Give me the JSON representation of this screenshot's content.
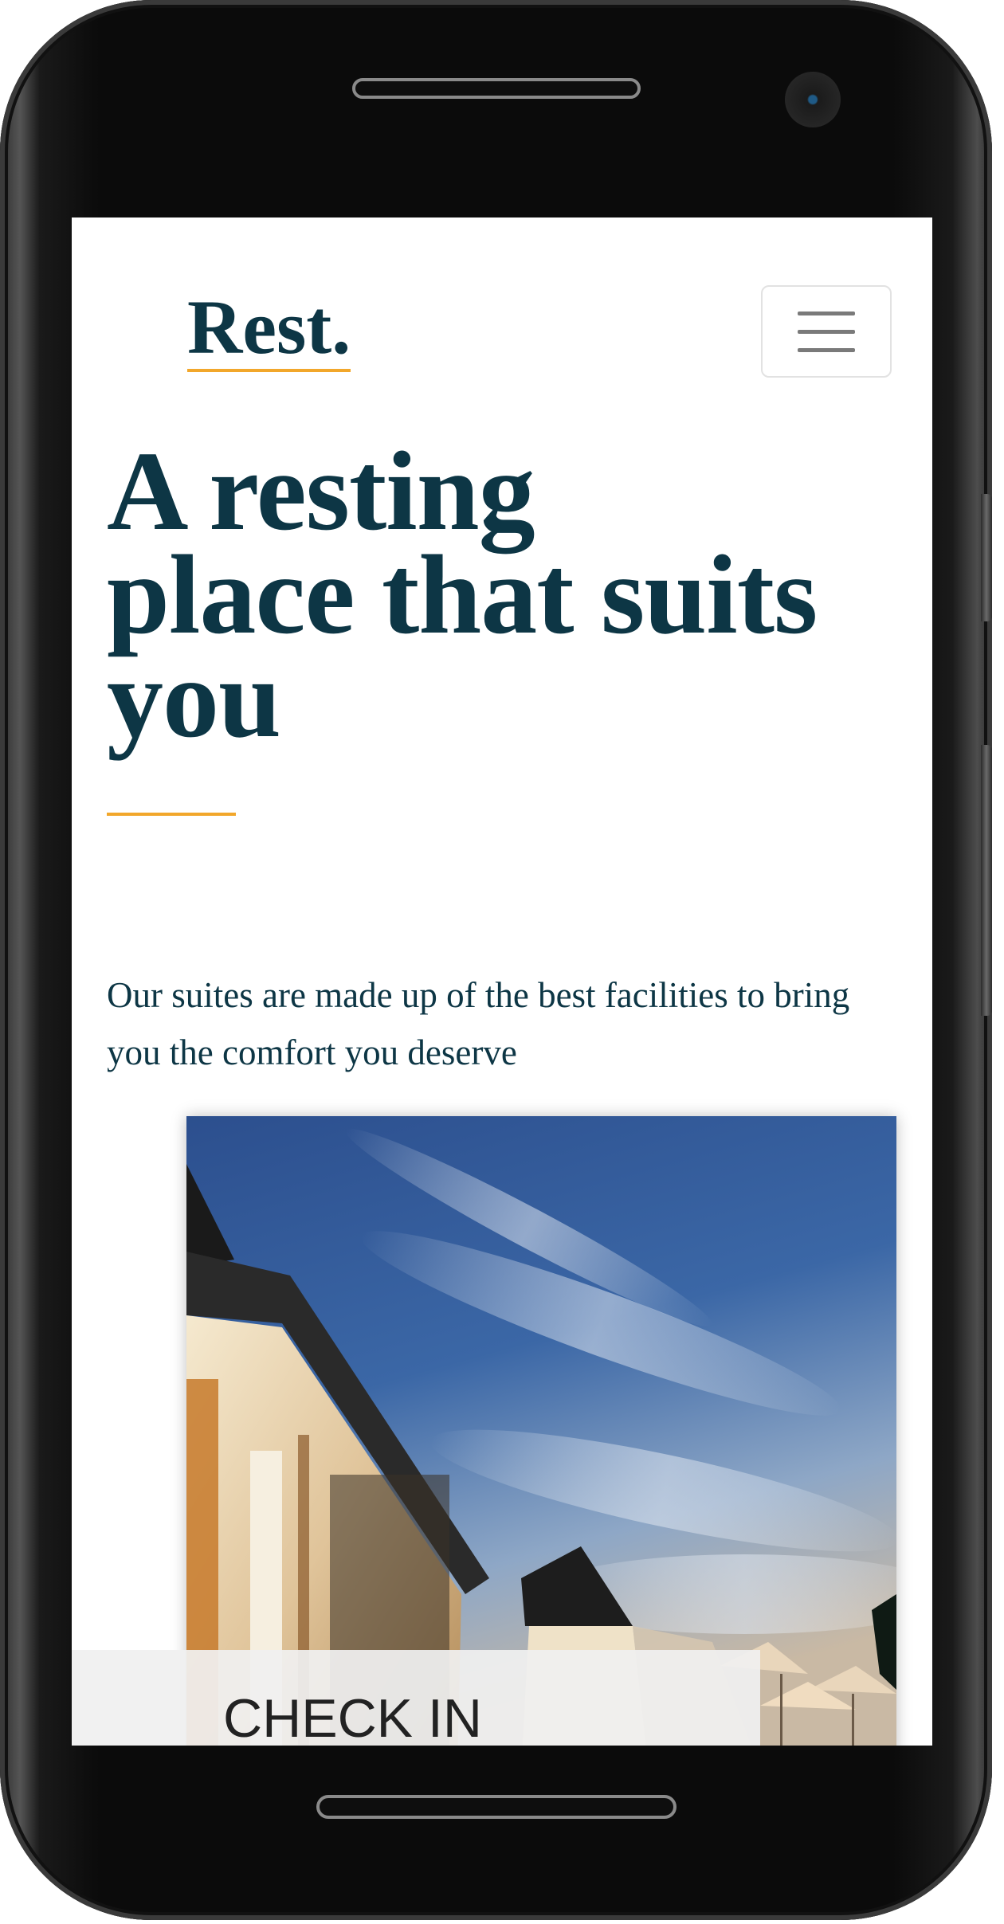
{
  "brand": {
    "logo_text": "Rest.",
    "primary_color": "#0d3645",
    "accent_color": "#f2a72b"
  },
  "nav": {
    "menu_icon": "hamburger-icon"
  },
  "hero": {
    "title_lines": [
      "A resting",
      "place that suits",
      "you"
    ],
    "lead": "Our suites are made up of the best facilities to bring you the comfort you deserve"
  },
  "booking": {
    "check_in_label": "CHECK IN"
  }
}
